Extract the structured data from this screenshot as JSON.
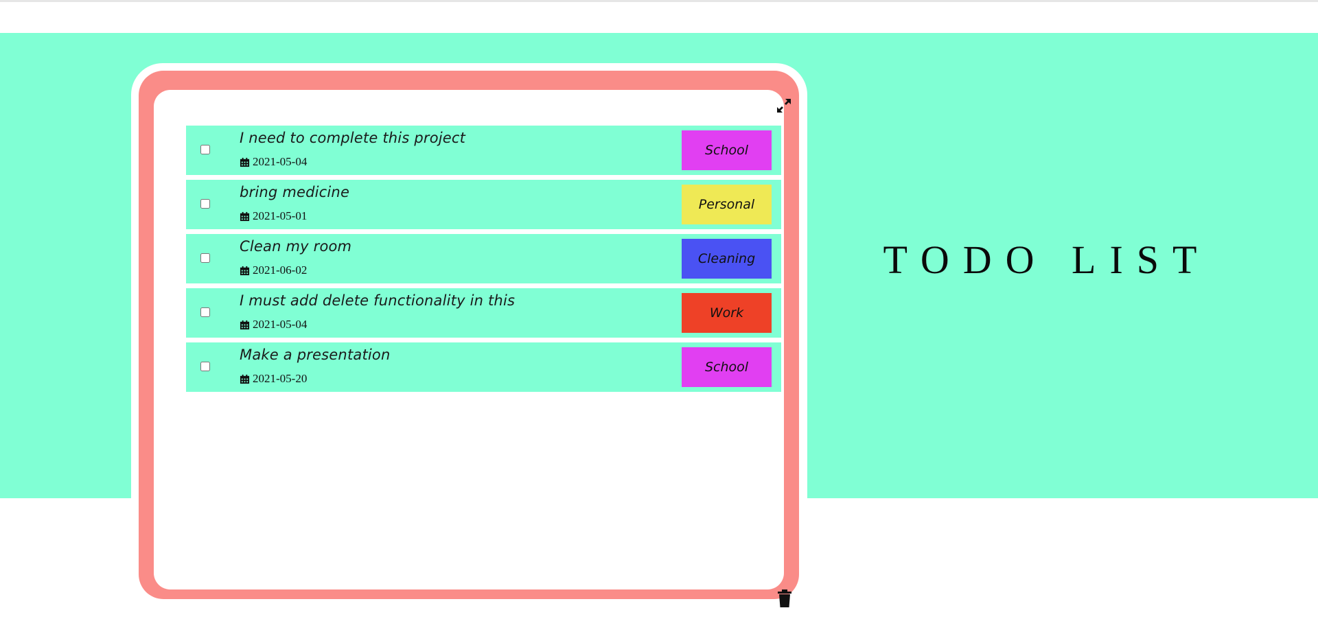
{
  "header": {
    "title": "TODO LIST"
  },
  "tasks": [
    {
      "text": "I need to complete this project",
      "date": "2021-05-04",
      "category": "School",
      "category_color": "#e13ff2",
      "checked": false
    },
    {
      "text": "bring medicine",
      "date": "2021-05-01",
      "category": "Personal",
      "category_color": "#efe955",
      "checked": false
    },
    {
      "text": "Clean my room",
      "date": "2021-06-02",
      "category": "Cleaning",
      "category_color": "#4a52f3",
      "checked": false
    },
    {
      "text": "I must add delete functionality in this",
      "date": "2021-05-04",
      "category": "Work",
      "category_color": "#ee4127",
      "checked": false
    },
    {
      "text": "Make a presentation",
      "date": "2021-05-20",
      "category": "School",
      "category_color": "#e13ff2",
      "checked": false
    }
  ],
  "icons": {
    "expand": "expand-icon",
    "trash": "trash-icon",
    "calendar": "calendar-icon"
  },
  "colors": {
    "band": "#80ffd4",
    "card_border": "#fa8c88",
    "task_row": "#80ffd4"
  }
}
